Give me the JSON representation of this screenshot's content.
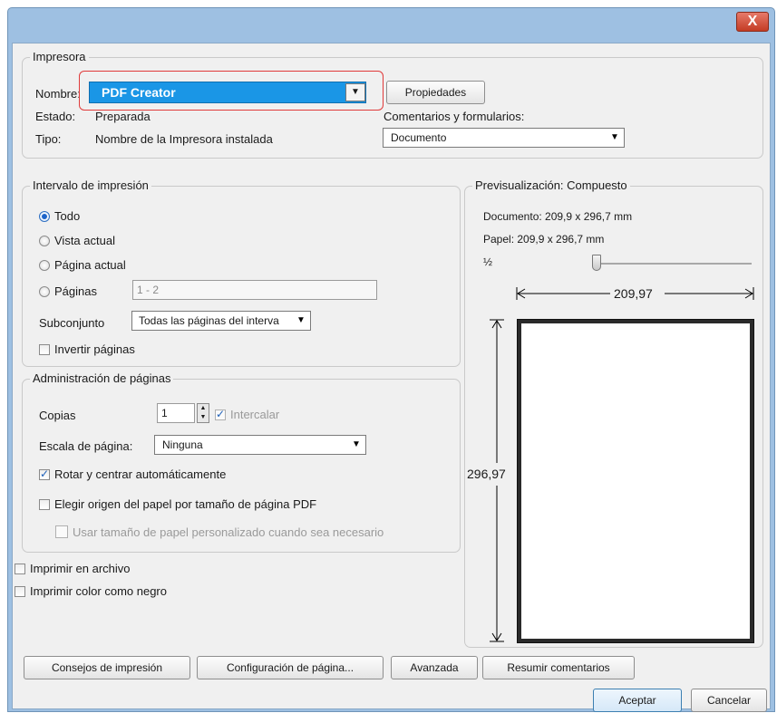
{
  "window": {
    "close_glyph": "X"
  },
  "printer": {
    "legend": "Impresora",
    "name_label": "Nombre:",
    "name_value": "PDF Creator",
    "properties_button": "Propiedades",
    "status_label": "Estado:",
    "status_value": "Preparada",
    "type_label": "Tipo:",
    "type_value": "Nombre de la Impresora instalada",
    "comments_label": "Comentarios y formularios:",
    "comments_value": "Documento"
  },
  "range": {
    "legend": "Intervalo de impresión",
    "all": "Todo",
    "current_view": "Vista actual",
    "current_page": "Página actual",
    "pages": "Páginas",
    "pages_value": "1 - 2",
    "subset_label": "Subconjunto",
    "subset_value": "Todas las páginas del interva",
    "reverse": "Invertir páginas"
  },
  "handling": {
    "legend": "Administración de páginas",
    "copies_label": "Copias",
    "copies_value": "1",
    "collate": "Intercalar",
    "scale_label": "Escala de página:",
    "scale_value": "Ninguna",
    "auto_rotate": "Rotar y centrar automáticamente",
    "paper_source": "Elegir origen del papel por tamaño de página PDF",
    "custom_paper": "Usar tamaño de papel personalizado cuando sea necesario"
  },
  "options": {
    "print_to_file": "Imprimir en archivo",
    "print_black": "Imprimir color como negro"
  },
  "preview": {
    "legend": "Previsualización: Compuesto",
    "document": "Documento: 209,9 x 296,7 mm",
    "paper": "Papel: 209,9 x 296,7 mm",
    "zoom": "½",
    "width": "209,97",
    "height": "296,97"
  },
  "buttons": {
    "tips": "Consejos de impresión",
    "page_setup": "Configuración de página...",
    "advanced": "Avanzada",
    "summarize": "Resumir comentarios",
    "ok": "Aceptar",
    "cancel": "Cancelar"
  },
  "colors": {
    "titlebar": "#9ec0e2",
    "printer_select": "#1a96e6",
    "highlight_outline": "#e03a3a",
    "close_button": "#c43c24"
  },
  "icons": {
    "close": "close-icon",
    "dropdown": "chevron-down-icon",
    "spin": "spinner-arrows-icon"
  }
}
